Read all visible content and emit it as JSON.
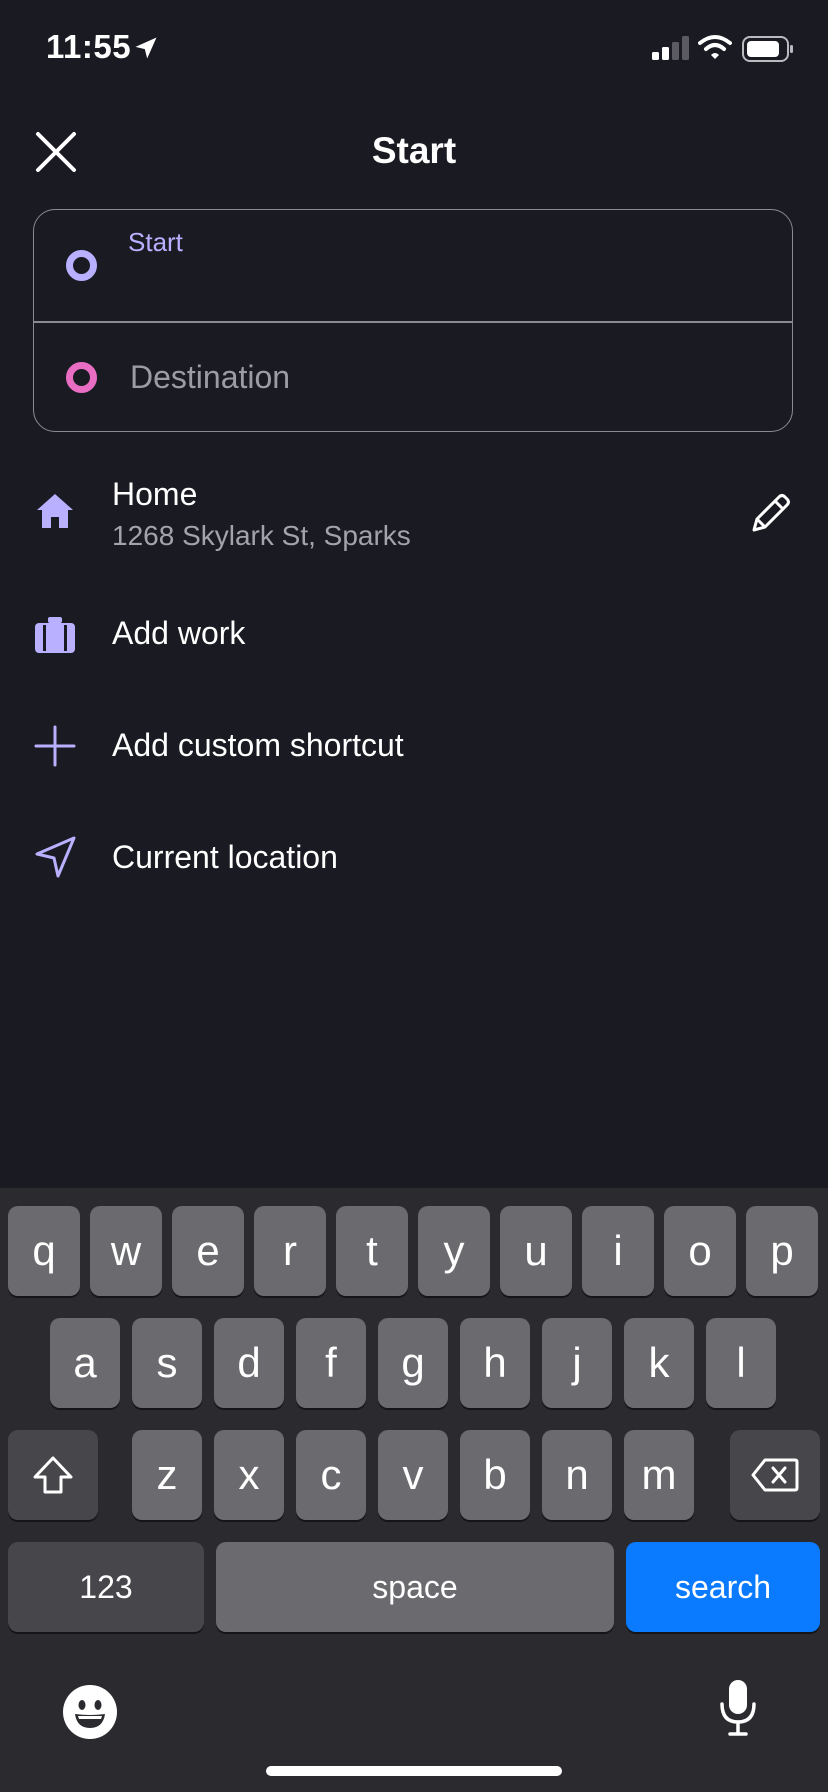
{
  "status_bar": {
    "time": "11:55"
  },
  "header": {
    "title": "Start"
  },
  "route": {
    "start_label": "Start",
    "start_value": "",
    "destination_placeholder": "Destination"
  },
  "shortcuts": {
    "home": {
      "title": "Home",
      "address": "1268 Skylark St, Sparks"
    },
    "work": {
      "title": "Add work"
    },
    "custom": {
      "title": "Add custom shortcut"
    },
    "current": {
      "title": "Current location"
    }
  },
  "keyboard": {
    "row1": [
      "q",
      "w",
      "e",
      "r",
      "t",
      "y",
      "u",
      "i",
      "o",
      "p"
    ],
    "row2": [
      "a",
      "s",
      "d",
      "f",
      "g",
      "h",
      "j",
      "k",
      "l"
    ],
    "row3": [
      "z",
      "x",
      "c",
      "v",
      "b",
      "n",
      "m"
    ],
    "numbers_label": "123",
    "space_label": "space",
    "search_label": "search"
  },
  "colors": {
    "background": "#1a1a22",
    "accent_start": "#b9b0ff",
    "accent_destination": "#e86dc3",
    "search_key": "#0a7aff"
  }
}
